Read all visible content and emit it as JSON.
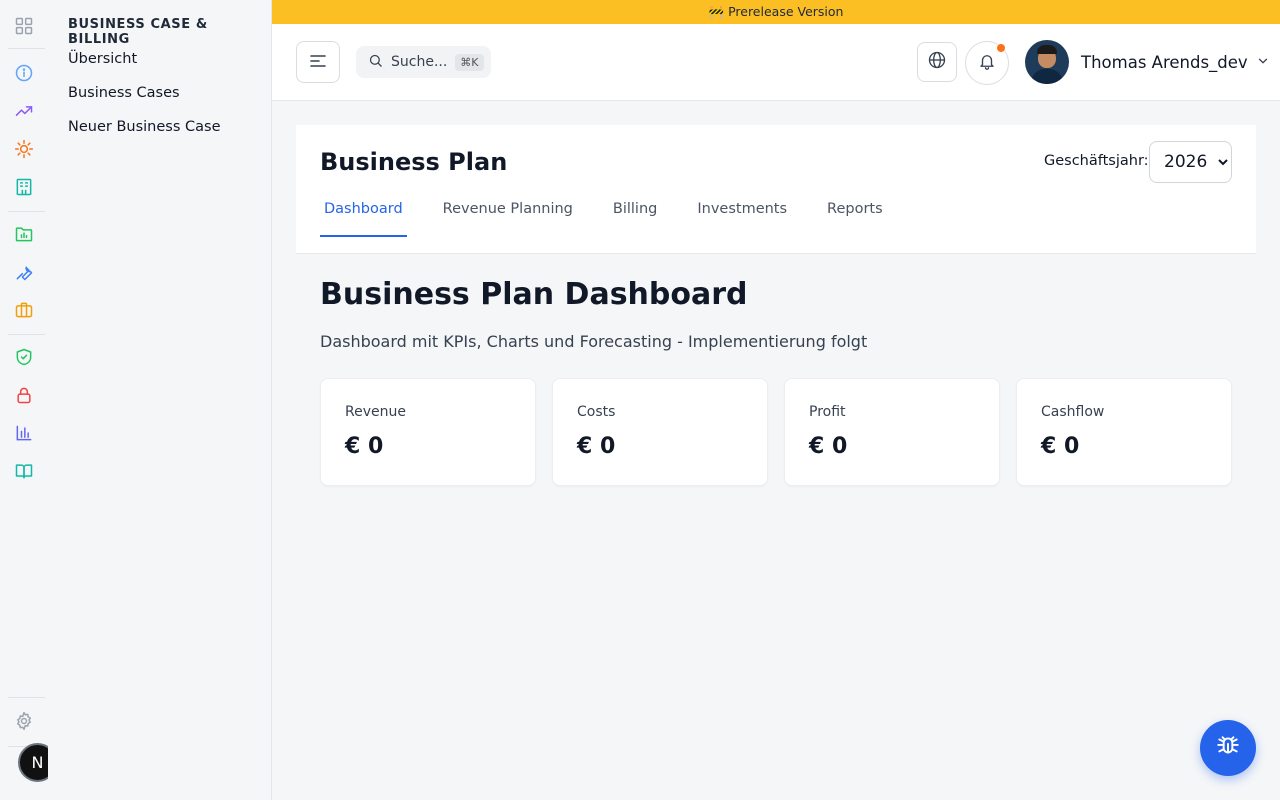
{
  "banner": {
    "text": "🚧 Prerelease Version",
    "color": "#fbbf24"
  },
  "rail": {
    "icons": [
      "grid-icon",
      "info-icon",
      "trending-up-icon",
      "gear-sun-icon",
      "building-icon",
      "folder-chart-icon",
      "wrench-icon",
      "briefcase-icon",
      "shield-check-icon",
      "lock-icon",
      "bar-chart-icon",
      "book-open-icon",
      "settings-icon"
    ],
    "badge": "N"
  },
  "subnav": {
    "title": "BUSINESS CASE & BILLING",
    "items": [
      {
        "label": "Übersicht"
      },
      {
        "label": "Business Cases"
      },
      {
        "label": "Neuer Business Case"
      }
    ]
  },
  "header": {
    "search": {
      "placeholder": "Suche...",
      "shortcut": "⌘K"
    },
    "user": {
      "name": "Thomas Arends_dev"
    }
  },
  "page": {
    "title": "Business Plan",
    "fiscal_year_label": "Geschäftsjahr:",
    "fiscal_year": "2026",
    "tabs": [
      {
        "label": "Dashboard",
        "active": true
      },
      {
        "label": "Revenue Planning",
        "active": false
      },
      {
        "label": "Billing",
        "active": false
      },
      {
        "label": "Investments",
        "active": false
      },
      {
        "label": "Reports",
        "active": false
      }
    ],
    "dashboard_title": "Business Plan Dashboard",
    "dashboard_subtitle": "Dashboard mit KPIs, Charts und Forecasting - Implementierung folgt",
    "kpis": [
      {
        "label": "Revenue",
        "value": "€ 0"
      },
      {
        "label": "Costs",
        "value": "€ 0"
      },
      {
        "label": "Profit",
        "value": "€ 0"
      },
      {
        "label": "Cashflow",
        "value": "€ 0"
      }
    ]
  },
  "colors": {
    "accent": "#2563eb",
    "notification": "#f97316"
  }
}
